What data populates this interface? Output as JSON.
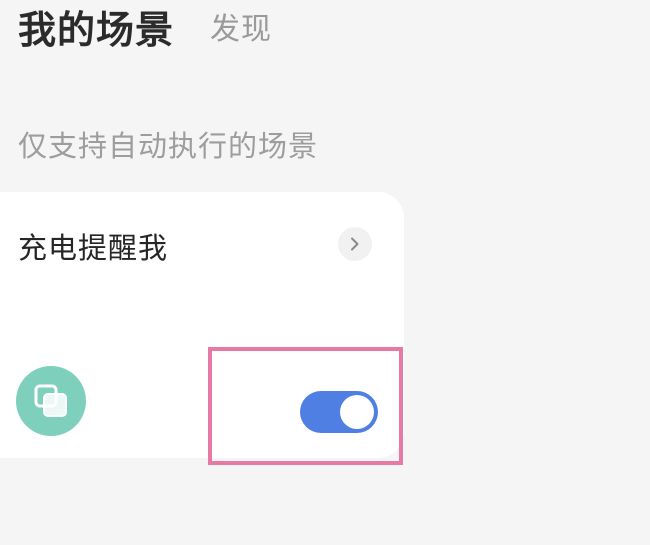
{
  "header": {
    "tab_active": "我的场景",
    "tab_inactive": "发现"
  },
  "section": {
    "label": "仅支持自动执行的场景"
  },
  "scene_card": {
    "title": "充电提醒我",
    "chevron_icon": "chevron-right-icon",
    "scene_icon": "copy-icon",
    "toggle_on": true
  },
  "colors": {
    "background": "#f5f5f5",
    "card": "#ffffff",
    "toggle_on": "#4f7fe3",
    "scene_icon_bg": "#7fcfbd",
    "highlight": "#e77aa4"
  }
}
